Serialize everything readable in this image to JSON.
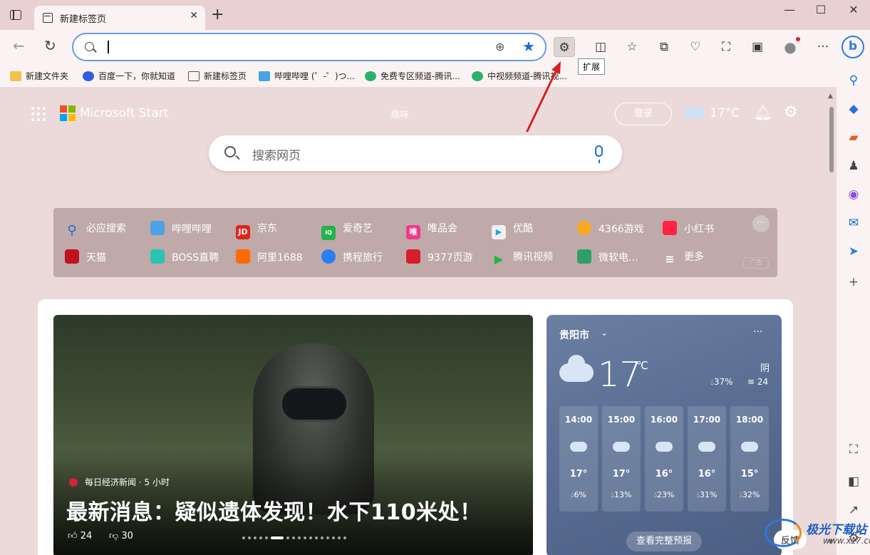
{
  "tab": {
    "title": "新建标签页"
  },
  "window_controls": [
    "—",
    "☐",
    "✕"
  ],
  "address_bar": {
    "value": "",
    "placeholder": ""
  },
  "toolbar": {
    "tooltip": "扩展"
  },
  "favorites": [
    {
      "label": "新建文件夹",
      "color": "#f2c24a"
    },
    {
      "label": "百度一下，你就知道",
      "color": "#2e5fe0"
    },
    {
      "label": "新建标签页",
      "color": "#555555"
    },
    {
      "label": "哔哩哔哩 (゜-゜)つ...",
      "color": "#4aa3e4"
    },
    {
      "label": "免费专区频道-腾讯...",
      "color": "#28b36a"
    },
    {
      "label": "中视频频道-腾讯视...",
      "color": "#28b36a"
    }
  ],
  "ntp": {
    "brand": "Microsoft Start",
    "top_link": "趣味",
    "login": "登录",
    "weather_temp": "17°C",
    "search_placeholder": "搜索网页"
  },
  "quick_links": [
    {
      "label": "必应搜索",
      "color": "#1f6fd1",
      "glyph": ""
    },
    {
      "label": "哔哩哔哩",
      "color": "#4aa3e4",
      "glyph": ""
    },
    {
      "label": "京东",
      "color": "#e1251b",
      "glyph": "JD"
    },
    {
      "label": "爱奇艺",
      "color": "#22b34a",
      "glyph": "iQ"
    },
    {
      "label": "唯品会",
      "color": "#f03a8c",
      "glyph": "唯"
    },
    {
      "label": "优酷",
      "color": "#f0f0f0",
      "glyph": ""
    },
    {
      "label": "4366游戏",
      "color": "#f7a824",
      "glyph": ""
    },
    {
      "label": "小红书",
      "color": "#ff2442",
      "glyph": ""
    },
    {
      "label": "天猫",
      "color": "#c1121f",
      "glyph": ""
    },
    {
      "label": "BOSS直聘",
      "color": "#2bc3b3",
      "glyph": ""
    },
    {
      "label": "阿里1688",
      "color": "#ff6a00",
      "glyph": ""
    },
    {
      "label": "携程旅行",
      "color": "#2a7ef4",
      "glyph": ""
    },
    {
      "label": "9377页游",
      "color": "#d71c2c",
      "glyph": ""
    },
    {
      "label": "腾讯视频",
      "color": "#22b34a",
      "glyph": ""
    },
    {
      "label": "微软电...",
      "color": "#2e9e6b",
      "glyph": ""
    },
    {
      "label": "更多",
      "color": "transparent",
      "glyph": "≡"
    }
  ],
  "quick_links_ad": "广告",
  "hero": {
    "source": "每日经济新闻 · 5 小时",
    "headline": "最新消息：疑似遗体发现！水下110米处！",
    "likes": "24",
    "dislikes": "30"
  },
  "weather": {
    "city": "贵阳市",
    "temp": "17",
    "unit": "℃",
    "condition": "阴",
    "humidity": "37%",
    "wind": "24",
    "hourly": [
      {
        "time": "14:00",
        "temp": "17°",
        "precip": "6%",
        "icon": "cloud"
      },
      {
        "time": "15:00",
        "temp": "17°",
        "precip": "13%",
        "icon": "cloud"
      },
      {
        "time": "16:00",
        "temp": "16°",
        "precip": "23%",
        "icon": "cloud"
      },
      {
        "time": "17:00",
        "temp": "16°",
        "precip": "31%",
        "icon": "cloud"
      },
      {
        "time": "18:00",
        "temp": "15°",
        "precip": "32%",
        "icon": "partly-sunny"
      }
    ],
    "forecast_button": "查看完整预报"
  },
  "feedback": "反馈",
  "watermark": {
    "title": "极光下载站",
    "sub": "www.xz7.com"
  },
  "colors": {
    "accent": "#1a6cd4",
    "arrow": "#d22222"
  }
}
